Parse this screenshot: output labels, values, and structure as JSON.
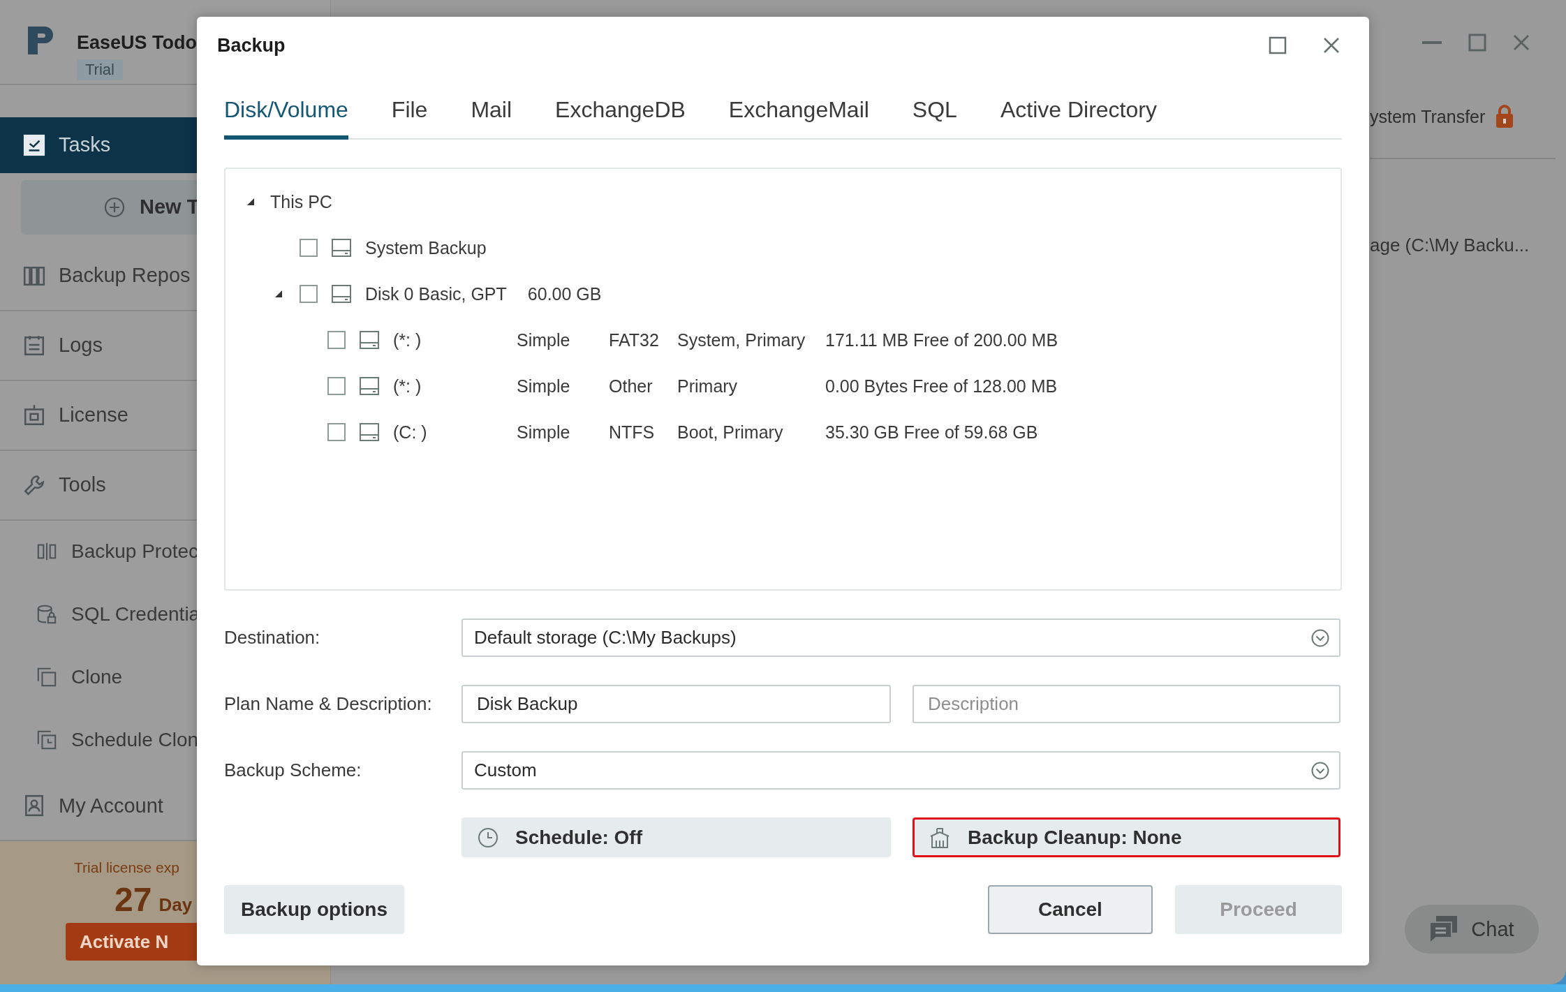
{
  "app": {
    "name": "EaseUS Todo",
    "edition": "Trial",
    "nav": [
      {
        "label": "Tasks",
        "kind": "main",
        "selected": true
      },
      {
        "label": "New T",
        "kind": "new",
        "selected": false
      },
      {
        "label": "Backup Repos",
        "kind": "main",
        "selected": false
      },
      {
        "label": "Logs",
        "kind": "main",
        "selected": false
      },
      {
        "label": "License",
        "kind": "main",
        "selected": false
      },
      {
        "label": "Tools",
        "kind": "main",
        "selected": false
      },
      {
        "label": "Backup Protec",
        "kind": "sub",
        "selected": false
      },
      {
        "label": "SQL Credentia",
        "kind": "sub",
        "selected": false
      },
      {
        "label": "Clone",
        "kind": "sub",
        "selected": false
      },
      {
        "label": "Schedule Clon",
        "kind": "sub",
        "selected": false
      },
      {
        "label": "My Account",
        "kind": "main",
        "selected": false
      }
    ],
    "trial": {
      "message": "Trial license exp",
      "days": "27",
      "days_unit": "Day",
      "button": "Activate N"
    },
    "header_link": "ystem Transfer",
    "task_path": "age (C:\\My Backu...",
    "chat": "Chat"
  },
  "dialog": {
    "title": "Backup",
    "tabs": [
      {
        "label": "Disk/Volume",
        "selected": true
      },
      {
        "label": "File",
        "selected": false
      },
      {
        "label": "Mail",
        "selected": false
      },
      {
        "label": "ExchangeDB",
        "selected": false
      },
      {
        "label": "ExchangeMail",
        "selected": false
      },
      {
        "label": "SQL",
        "selected": false
      },
      {
        "label": "Active Directory",
        "selected": false
      }
    ],
    "tree": [
      {
        "label": "This PC",
        "expanded": true,
        "children": [
          {
            "label": "System Backup",
            "kind": "item",
            "checked": false
          },
          {
            "label": "Disk 0 Basic, GPT",
            "kind": "disk",
            "size": "60.00 GB",
            "checked": false,
            "expanded": true,
            "children": [
              {
                "label": "(*: )",
                "kind": "partition",
                "checked": false,
                "type": "Simple",
                "fs": "FAT32",
                "flags": "System, Primary",
                "free": "171.11 MB Free of 200.00 MB"
              },
              {
                "label": "(*: )",
                "kind": "partition",
                "checked": false,
                "type": "Simple",
                "fs": "Other",
                "flags": "Primary",
                "free": "0.00 Bytes Free of 128.00 MB"
              },
              {
                "label": "(C: )",
                "kind": "partition",
                "checked": false,
                "type": "Simple",
                "fs": "NTFS",
                "flags": "Boot, Primary",
                "free": "35.30 GB Free of 59.68 GB"
              }
            ]
          }
        ]
      }
    ],
    "destination": {
      "label": "Destination:",
      "value": "Default storage (C:\\My Backups)"
    },
    "plan": {
      "label": "Plan Name & Description:",
      "name": "Disk Backup",
      "description_placeholder": "Description"
    },
    "scheme": {
      "label": "Backup Scheme:",
      "value": "Custom"
    },
    "schedule": {
      "label": "Schedule: Off",
      "highlighted": false
    },
    "cleanup": {
      "label": "Backup Cleanup: None",
      "highlighted": true
    },
    "buttons": [
      {
        "label": "Backup options",
        "kind": "options",
        "disabled": false
      },
      {
        "label": "Cancel",
        "kind": "cancel",
        "disabled": false
      },
      {
        "label": "Proceed",
        "kind": "proceed",
        "disabled": true
      }
    ]
  }
}
